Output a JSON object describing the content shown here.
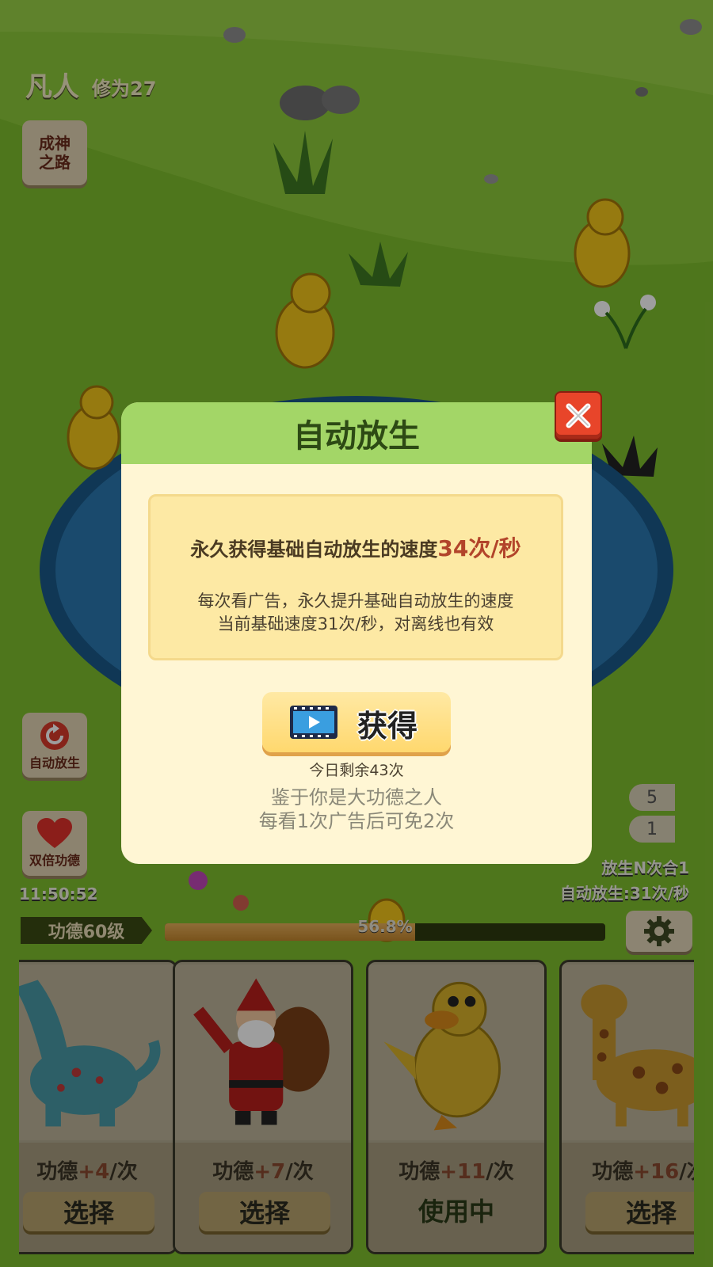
{
  "player": {
    "rank": "凡人",
    "cultivation": "修为27"
  },
  "side_buttons": {
    "path_to_god": "成神\n之路",
    "auto_release": "自动放生",
    "double_merit": "双倍功德"
  },
  "clock": "11:50:52",
  "right_panel": {
    "pill1": "5",
    "pill2": "1",
    "merge": "放生N次合1",
    "auto_speed": "自动放生:31次/秒"
  },
  "progress": {
    "level_label": "功德60级",
    "percent_text": "56.8%",
    "fraction": 0.568
  },
  "cards": [
    {
      "animal": "dinosaur",
      "merit_prefix": "功德",
      "merit_value": "+4",
      "merit_suffix": "/次",
      "button": "选择",
      "in_use": false
    },
    {
      "animal": "santa",
      "merit_prefix": "功德",
      "merit_value": "+7",
      "merit_suffix": "/次",
      "button": "选择",
      "in_use": false
    },
    {
      "animal": "duck",
      "merit_prefix": "功德",
      "merit_value": "+11",
      "merit_suffix": "/次",
      "button": "使用中",
      "in_use": true
    },
    {
      "animal": "giraffe",
      "merit_prefix": "功德",
      "merit_value": "+16",
      "merit_suffix": "/次",
      "button": "选择",
      "in_use": false
    }
  ],
  "modal": {
    "title": "自动放生",
    "headline_prefix": "永久获得基础自动放生的速度",
    "headline_value": "34次/秒",
    "desc_line1": "每次看广告，永久提升基础自动放生的速度",
    "desc_line2": "当前基础速度31次/秒，对离线也有效",
    "get_button": "获得",
    "remaining": "今日剩余43次",
    "note_line1": "鉴于你是大功德之人",
    "note_line2": "每看1次广告后可免2次"
  },
  "colors": {
    "header_green": "#a3d667",
    "modal_bg": "#fff6d4",
    "highlight_red": "#b2442a",
    "close_red": "#e8452a"
  }
}
